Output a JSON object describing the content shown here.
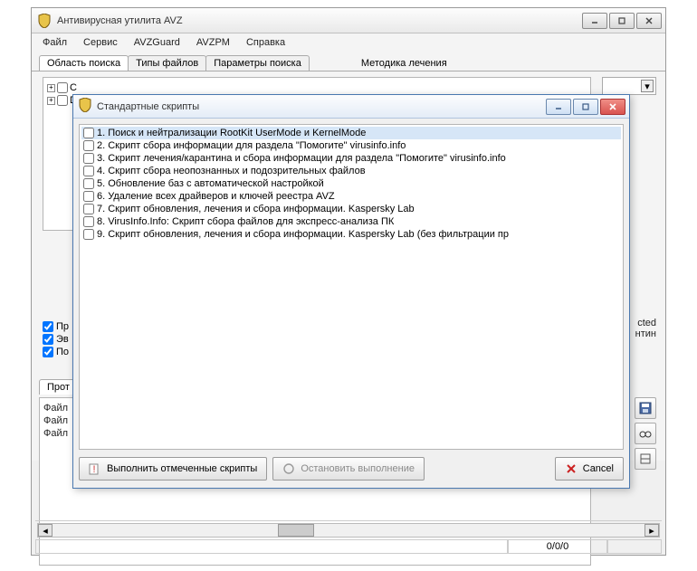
{
  "main": {
    "title": "Антивирусная утилита AVZ",
    "menu": [
      "Файл",
      "Сервис",
      "AVZGuard",
      "AVZPM",
      "Справка"
    ],
    "tabs": [
      "Область поиска",
      "Типы файлов",
      "Параметры поиска"
    ],
    "rightTab": "Методика лечения",
    "treeItems": [
      "C",
      "D"
    ],
    "checks": [
      "Пр",
      "Эв",
      "По"
    ],
    "rightText1": "cted",
    "rightText2": "нтин",
    "protoTab": "Прот",
    "log": [
      "Файл",
      "Файл",
      "Файл"
    ],
    "status": "0/0/0"
  },
  "dialog": {
    "title": "Стандартные скрипты",
    "scripts": [
      "1. Поиск и нейтрализации RootKit UserMode и KernelMode",
      "2. Скрипт сбора информации для раздела \"Помогите\" virusinfo.info",
      "3. Скрипт лечения/карантина и сбора информации для раздела \"Помогите\" virusinfo.info",
      "4. Скрипт сбора неопознанных и подозрительных файлов",
      "5. Обновление баз с автоматической настройкой",
      "6. Удаление всех драйверов и ключей реестра AVZ",
      "7. Скрипт обновления, лечения и сбора информации. Kaspersky Lab",
      "8. VirusInfo.Info: Скрипт сбора файлов для экспресс-анализа ПК",
      "9. Скрипт обновления, лечения и сбора информации. Kaspersky Lab (без фильтрации пр"
    ],
    "runBtn": "Выполнить отмеченные скрипты",
    "stopBtn": "Остановить выполнение",
    "cancelBtn": "Cancel"
  }
}
